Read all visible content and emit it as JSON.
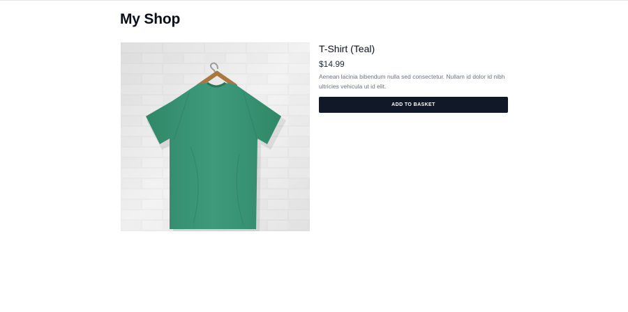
{
  "header": {
    "title": "My Shop"
  },
  "product": {
    "name": "T-Shirt (Teal)",
    "price": "$14.99",
    "description": "Aenean lacinia bibendum nulla sed consectetur. Nullam id dolor id nibh ultricies vehicula ut id elit.",
    "add_to_basket_label": "ADD TO BASKET",
    "image_icon": "teal-tshirt-on-hanger",
    "shirt_color": "#3f9a7c",
    "button_color": "#111827"
  }
}
